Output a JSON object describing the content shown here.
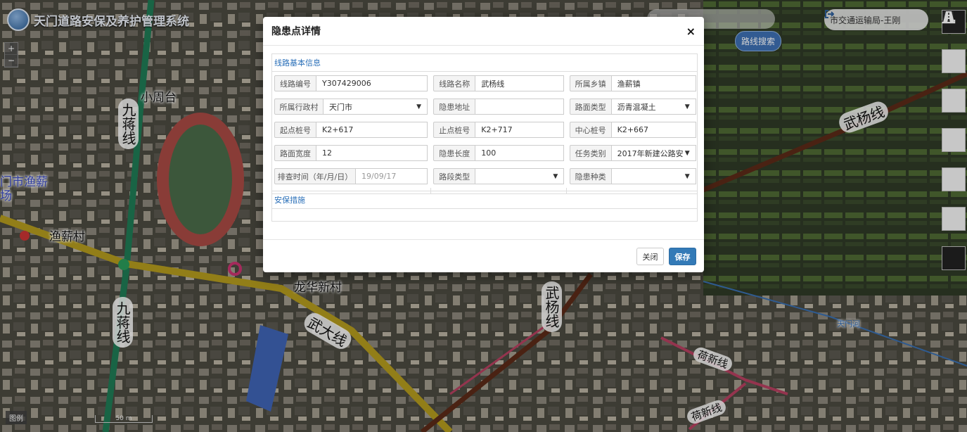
{
  "app": {
    "title": "天门道路安保及养护管理系统"
  },
  "map": {
    "zoom_in": "+",
    "zoom_out": "−",
    "labels": [
      "小周台",
      "渔薪村",
      "龙华新村",
      "门市渔薪",
      "场",
      "天门河"
    ],
    "roads": [
      "九蒋线",
      "九蒋线",
      "武杨线",
      "武杨线",
      "武大线",
      "荷新线",
      "荷新线"
    ],
    "scale_label": "50 m",
    "legend_label": "图例",
    "route_search": "路线搜索"
  },
  "user": {
    "name": "市交通运输局-王刚"
  },
  "toolbar": {
    "icons": [
      "download-icon",
      "layers-icon",
      "warning-icon",
      "road-sign-icon",
      "calendar-check-icon",
      "bar-chart-icon",
      "road-icon"
    ]
  },
  "modal": {
    "title": "隐患点详情",
    "close_symbol": "×",
    "section_basic": "线路基本信息",
    "section_measures": "安保措施",
    "fields": {
      "route_no": {
        "label": "线路编号",
        "value": "Y307429006"
      },
      "route_name": {
        "label": "线路名称",
        "value": "武杨线"
      },
      "township": {
        "label": "所属乡镇",
        "value": "渔薪镇"
      },
      "village": {
        "label": "所属行政村",
        "value": "天门市"
      },
      "hazard_addr": {
        "label": "隐患地址",
        "value": ""
      },
      "surface_type": {
        "label": "路面类型",
        "value": "沥青混凝土"
      },
      "start_stake": {
        "label": "起点桩号",
        "value": "K2+617"
      },
      "end_stake": {
        "label": "止点桩号",
        "value": "K2+717"
      },
      "center_stake": {
        "label": "中心桩号",
        "value": "K2+667"
      },
      "road_width": {
        "label": "路面宽度",
        "value": "12"
      },
      "hazard_len": {
        "label": "隐患长度",
        "value": "100"
      },
      "task_type": {
        "label": "任务类别",
        "value": "2017年新建公路安"
      },
      "check_time": {
        "label": "排查时间（年/月/日）",
        "value": "19/09/17"
      },
      "segment_type": {
        "label": "路段类型",
        "value": ""
      },
      "hazard_kind": {
        "label": "隐患种类",
        "value": ""
      }
    },
    "buttons": {
      "close": "关闭",
      "save": "保存"
    }
  }
}
